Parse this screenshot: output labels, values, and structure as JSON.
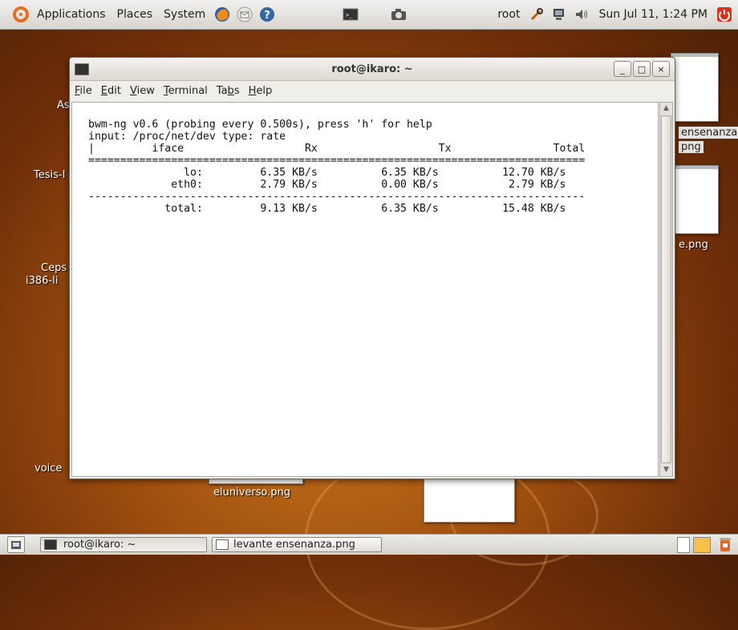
{
  "top_panel": {
    "menus": [
      "Applications",
      "Places",
      "System"
    ],
    "user": "root",
    "clock": "Sun Jul 11,  1:24 PM"
  },
  "desktop": {
    "labels": {
      "a": "As",
      "tesis": "Tesis-I",
      "ceps": "Ceps",
      "i386": "i386-li",
      "voice": "voice",
      "eluniverso": "eluniverso.png",
      "ensenanza": "ensenanza",
      "png": "png",
      "epng": "e.png"
    }
  },
  "window": {
    "title": "root@ikaro: ~",
    "buttons": {
      "minimize": "_",
      "maximize": "□",
      "close": "×"
    },
    "menu": {
      "file": {
        "key": "F",
        "rest": "ile"
      },
      "edit": {
        "key": "E",
        "rest": "dit"
      },
      "view": {
        "key": "V",
        "rest": "iew"
      },
      "terminal": {
        "key": "T",
        "rest": "erminal"
      },
      "tabs": {
        "pre": "Ta",
        "key": "b",
        "rest": "s"
      },
      "help": {
        "key": "H",
        "rest": "elp"
      }
    }
  },
  "terminal": {
    "lines": [
      "bwm-ng v0.6 (probing every 0.500s), press 'h' for help",
      "input: /proc/net/dev type: rate",
      "|         iface                   Rx                   Tx                Total",
      "==============================================================================",
      "               lo:         6.35 KB/s          6.35 KB/s          12.70 KB/s",
      "             eth0:         2.79 KB/s          0.00 KB/s           2.79 KB/s",
      "------------------------------------------------------------------------------",
      "            total:         9.13 KB/s          6.35 KB/s          15.48 KB/s"
    ]
  },
  "taskbar": {
    "tasks": [
      "root@ikaro: ~",
      "levante ensenanza.png"
    ]
  },
  "colors": {
    "wallpaper": "#a35210",
    "panel": "#e3e0db"
  }
}
